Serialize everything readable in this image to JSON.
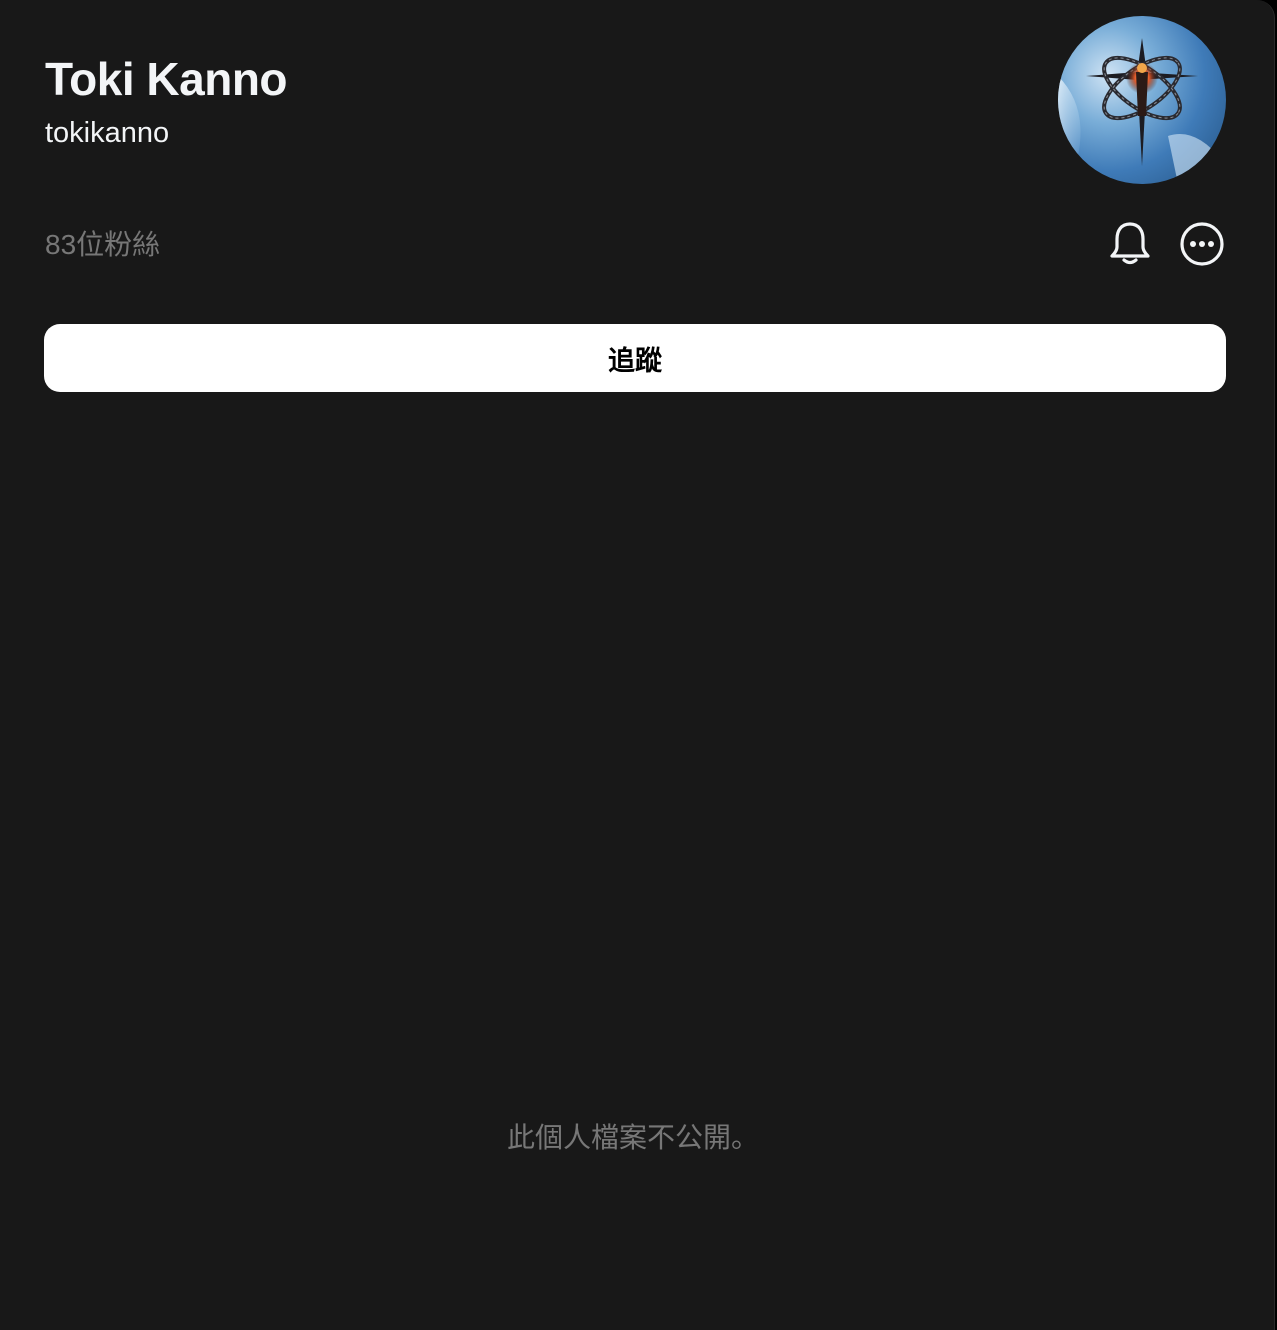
{
  "profile": {
    "display_name": "Toki Kanno",
    "username": "tokikanno",
    "followers_text": "83位粉絲",
    "avatar_icon": "avatar-image"
  },
  "actions": {
    "follow_label": "追蹤",
    "notifications_icon": "bell-icon",
    "more_icon": "more-options-icon"
  },
  "content": {
    "private_message": "此個人檔案不公開。"
  },
  "colors": {
    "background": "#181818",
    "text_primary": "#f3f5f7",
    "text_secondary": "#777777",
    "button_bg": "#ffffff",
    "button_text": "#000000"
  }
}
